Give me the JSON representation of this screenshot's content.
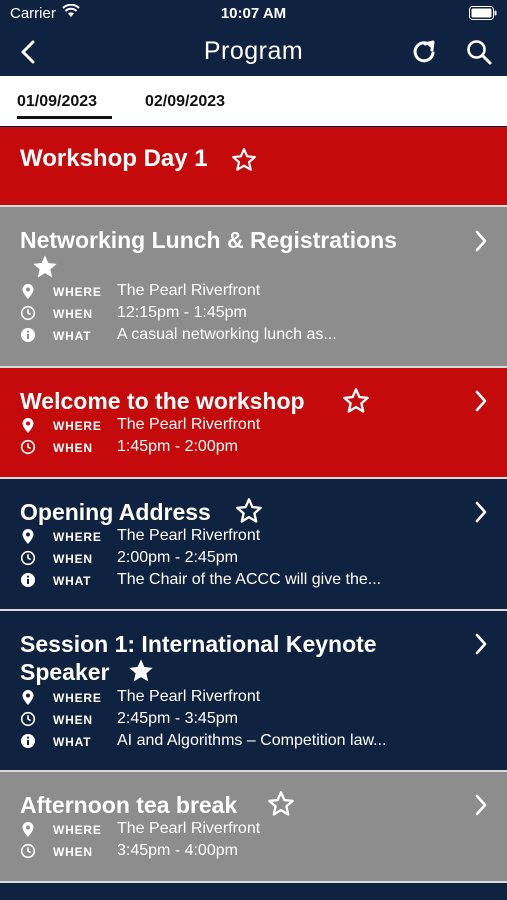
{
  "status_bar": {
    "carrier": "Carrier",
    "time": "10:07 AM"
  },
  "nav": {
    "title": "Program"
  },
  "tabs": [
    {
      "label": "01/09/2023",
      "active": true
    },
    {
      "label": "02/09/2023",
      "active": false
    }
  ],
  "day_header": {
    "title": "Workshop Day 1"
  },
  "labels": {
    "where": "WHERE",
    "when": "WHEN",
    "what": "WHAT"
  },
  "items": [
    {
      "title": "Networking Lunch & Registrations",
      "starred": true,
      "color": "#8d8d8d",
      "where": "The Pearl Riverfront",
      "when": "12:15pm - 1:45pm",
      "what": "A casual networking lunch as..."
    },
    {
      "title": "Welcome to the workshop",
      "starred": false,
      "color": "#c40a0a",
      "where": "The Pearl Riverfront",
      "when": "1:45pm - 2:00pm"
    },
    {
      "title": "Opening Address",
      "starred": false,
      "color": "#0f2341",
      "where": "The Pearl Riverfront",
      "when": "2:00pm - 2:45pm",
      "what": "The Chair of the ACCC will give the..."
    },
    {
      "title_line1": "Session 1: International Keynote",
      "title_line2": "Speaker",
      "starred": true,
      "color": "#0f2341",
      "where": "The Pearl Riverfront",
      "when": "2:45pm - 3:45pm",
      "what": "AI and Algorithms – Competition law..."
    },
    {
      "title": "Afternoon tea break",
      "starred": false,
      "color": "#8d8d8d",
      "where": "The Pearl Riverfront",
      "when": "3:45pm - 4:00pm"
    }
  ],
  "colors": {
    "navy": "#0f2341",
    "red": "#c40a0a",
    "grey": "#8d8d8d"
  }
}
